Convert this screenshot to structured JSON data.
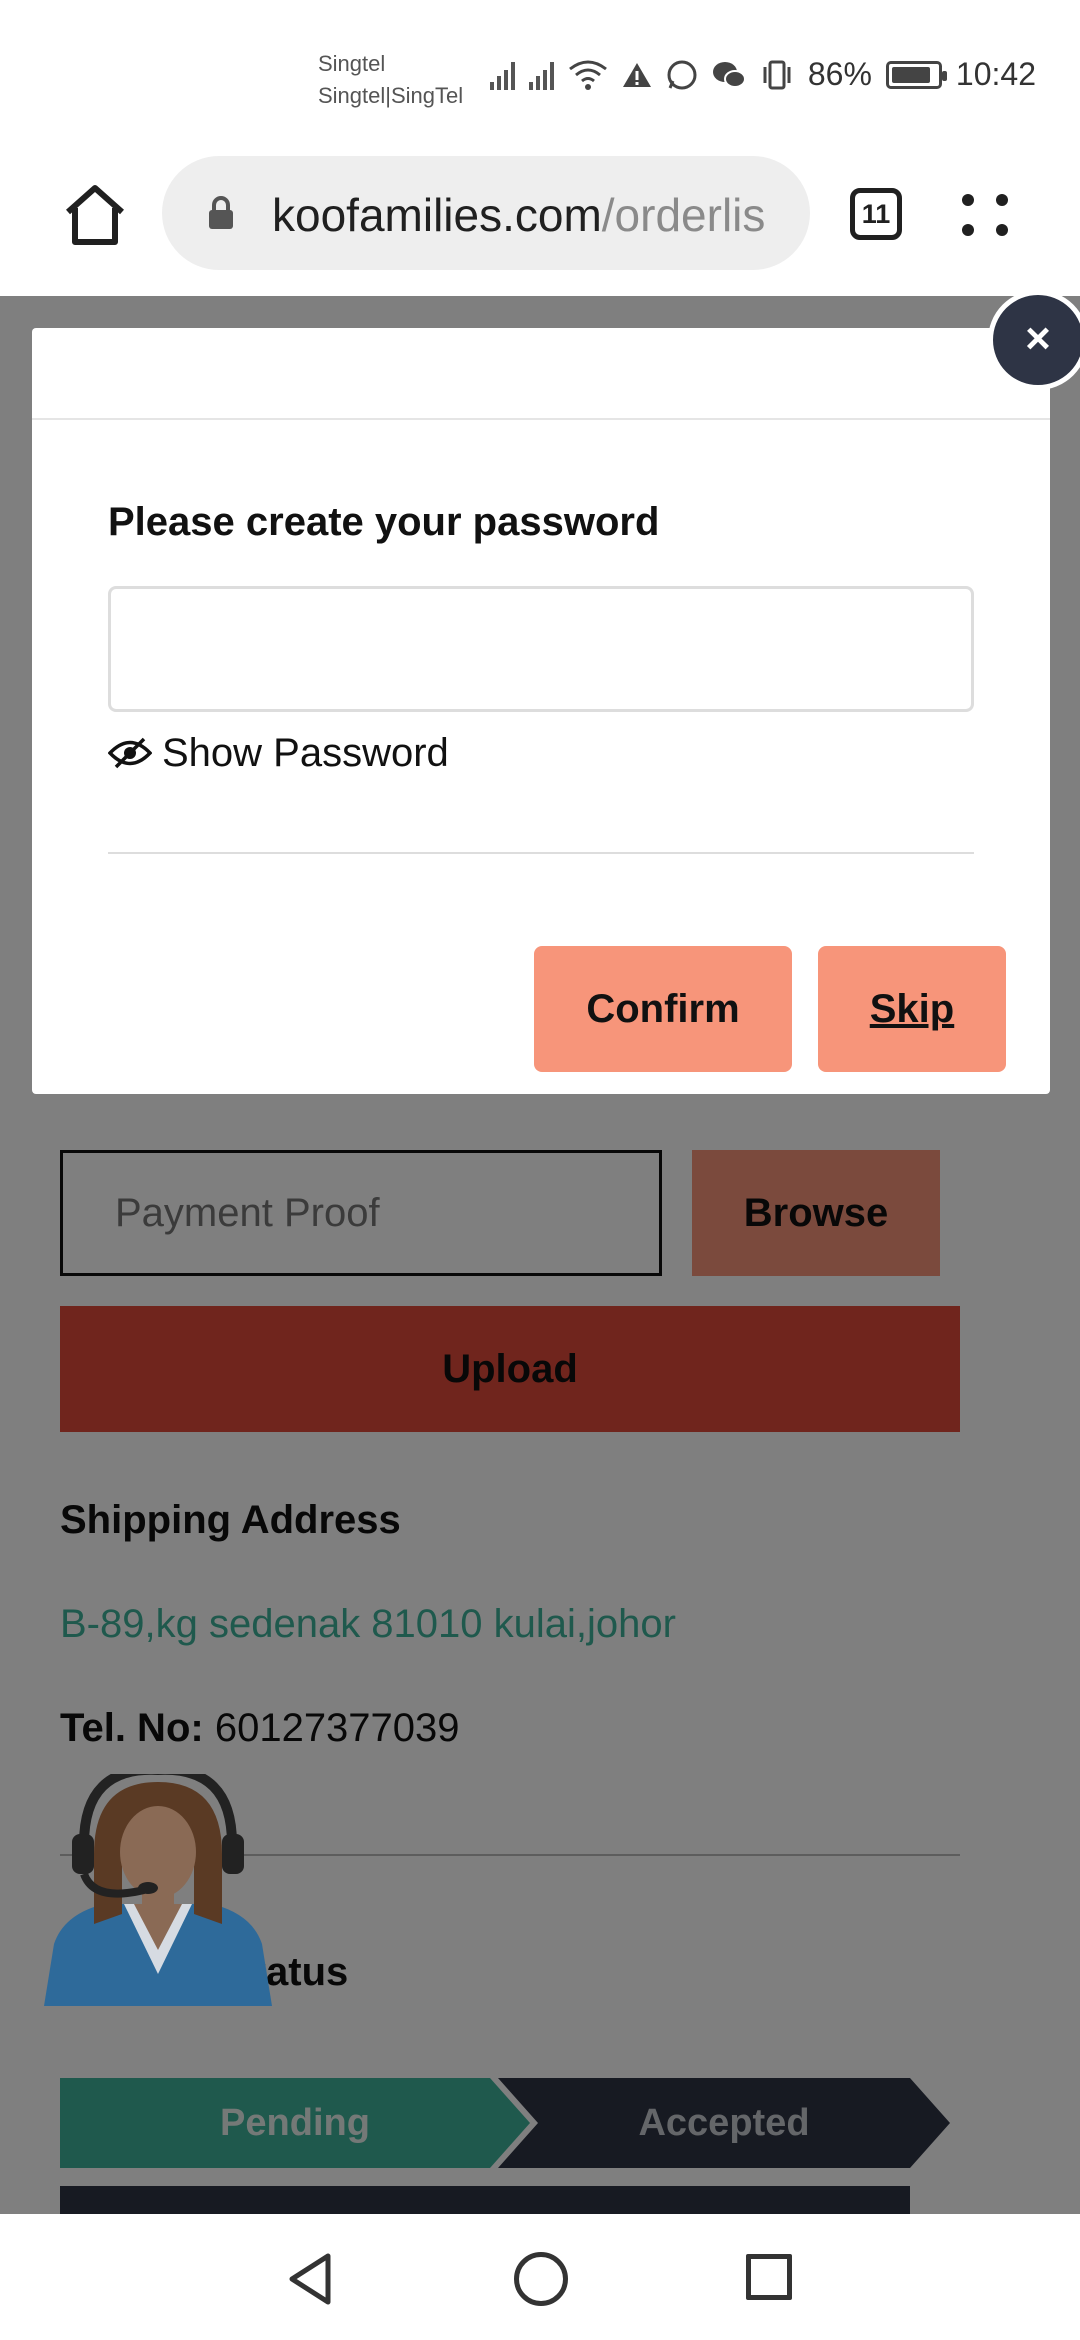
{
  "status_bar": {
    "carrier_line1": "Singtel",
    "carrier_line2": "Singtel|SingTel",
    "battery": "86%",
    "time": "10:42"
  },
  "browser": {
    "url_domain": "koofamilies.com",
    "url_path": "/orderlis",
    "tab_count": "11"
  },
  "modal": {
    "title": "Please create your password",
    "password_value": "",
    "show_password_label": "Show Password",
    "confirm_label": "Confirm",
    "skip_label": "Skip",
    "close_label": "×"
  },
  "page": {
    "payment_proof_placeholder": "Payment Proof",
    "browse_label": "Browse",
    "upload_label": "Upload",
    "shipping_title": "Shipping Address",
    "shipping_address": "B-89,kg sedenak 81010 kulai,johor",
    "tel_label": "Tel. No:",
    "tel_value": "60127377039",
    "order_status_title": "Status",
    "steps": {
      "pending": "Pending",
      "accepted": "Accepted"
    }
  },
  "colors": {
    "accent_salmon": "#f7957a",
    "upload_red": "#e04a3a",
    "teal": "#3fb39a",
    "navy": "#2e3445"
  }
}
